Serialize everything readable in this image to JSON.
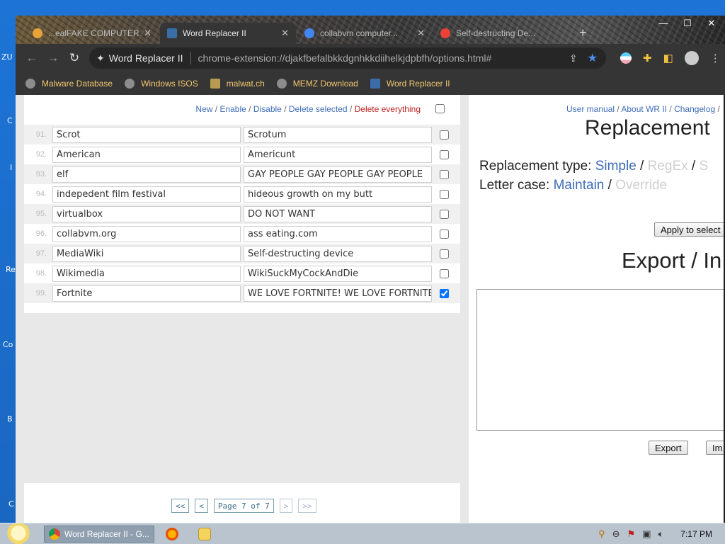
{
  "desktop": {
    "side_labels": [
      "ZU",
      "C",
      "I",
      "Re",
      "Co",
      "B",
      "C"
    ]
  },
  "browser": {
    "tabs": [
      {
        "title": "...ealFAKE COMPUTER",
        "active": false,
        "fav_color": "#e8a23a"
      },
      {
        "title": "Word Replacer II",
        "active": true,
        "fav_color": "#3b6ea8"
      },
      {
        "title": "collabvm computer...",
        "active": false,
        "fav_color": "#4285f4"
      },
      {
        "title": "Self-destructing De...",
        "active": false,
        "fav_color": "#ea4335"
      }
    ],
    "new_tab": "+",
    "window_controls": {
      "minimize": "—",
      "maximize": "☐",
      "close": "✕"
    },
    "back": "←",
    "forward": "→",
    "reload": "↻",
    "omnibox": {
      "extension_name": "Word Replacer II",
      "url": "chrome-extension://djakfbefalbkkdgnhkkdiihelkjdpbfh/options.html#"
    },
    "bookmarks": [
      {
        "label": "Malware Database"
      },
      {
        "label": "Windows ISOS"
      },
      {
        "label": "malwat.ch"
      },
      {
        "label": "MEMZ Download"
      },
      {
        "label": "Word Replacer II"
      }
    ]
  },
  "list": {
    "actions": {
      "new": "New",
      "enable": "Enable",
      "disable": "Disable",
      "delete_selected": "Delete selected",
      "delete_everything": "Delete everything",
      "sep": " / "
    },
    "rows": [
      {
        "num": "91.",
        "find": "Scrot",
        "replace": "Scrotum",
        "checked": false
      },
      {
        "num": "92.",
        "find": "American",
        "replace": "Americunt",
        "checked": false
      },
      {
        "num": "93.",
        "find": "elf",
        "replace": "GAY PEOPLE GAY PEOPLE GAY PEOPLE",
        "checked": false
      },
      {
        "num": "94.",
        "find": "indepedent film festival",
        "replace": "hideous growth on my butt",
        "checked": false
      },
      {
        "num": "95.",
        "find": "virtualbox",
        "replace": "DO NOT WANT",
        "checked": false
      },
      {
        "num": "96.",
        "find": "collabvm.org",
        "replace": "ass eating.com",
        "checked": false
      },
      {
        "num": "97.",
        "find": "MediaWiki",
        "replace": "Self-destructing device",
        "checked": false
      },
      {
        "num": "98.",
        "find": "Wikimedia",
        "replace": "WikiSuckMyCockAndDie",
        "checked": false
      },
      {
        "num": "99.",
        "find": "Fortnite",
        "replace": "WE LOVE FORTNITE! WE LOVE FORTNITE!",
        "checked": true
      }
    ],
    "pager": {
      "first": "<<",
      "prev": "<",
      "page": "Page 7 of 7",
      "next": ">",
      "last": ">>"
    }
  },
  "sidebar": {
    "links": {
      "manual": "User manual",
      "about": "About WR II",
      "changelog": "Changelog",
      "sep": " / "
    },
    "title": "Replacement",
    "type_label": "Replacement type:",
    "type_simple": "Simple",
    "type_regex": "RegEx",
    "type_cut": "S",
    "case_label": "Letter case:",
    "case_maintain": "Maintain",
    "case_override": "Override",
    "apply_button": "Apply to select",
    "export_title": "Export / In",
    "export_button": "Export",
    "import_button": "Im"
  },
  "taskbar": {
    "task_title": "Word Replacer II - G...",
    "clock": "7:17 PM"
  }
}
